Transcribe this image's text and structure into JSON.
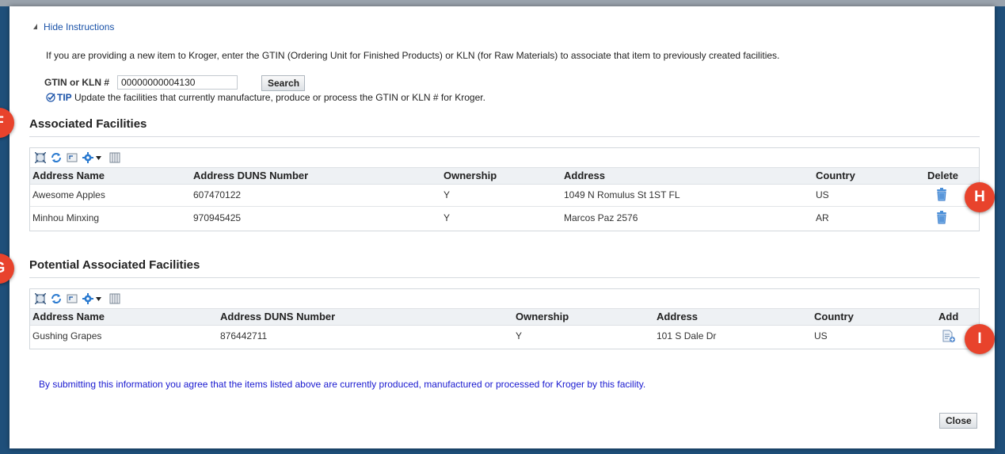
{
  "instructions": {
    "toggle_label": "Hide Instructions",
    "text": "If you are providing a new item to Kroger, enter the GTIN (Ordering Unit for Finished Products) or KLN (for Raw Materials) to associate that item to previously created facilities."
  },
  "search": {
    "label": "GTIN or KLN #",
    "value": "00000000004130",
    "button_label": "Search",
    "tip_word": "TIP",
    "tip_text": " Update the facilities that currently manufacture, produce or process the GTIN or KLN # for Kroger."
  },
  "associated": {
    "title": "Associated Facilities",
    "columns": [
      "Address Name",
      "Address DUNS Number",
      "Ownership",
      "Address",
      "Country",
      "Delete"
    ],
    "rows": [
      {
        "name": "Awesome Apples",
        "duns": "607470122",
        "ownership": "Y",
        "address": "1049 N Romulus St 1ST FL",
        "country": "US"
      },
      {
        "name": "Minhou Minxing",
        "duns": "970945425",
        "ownership": "Y",
        "address": "Marcos Paz 2576",
        "country": "AR"
      }
    ]
  },
  "potential": {
    "title": "Potential Associated Facilities",
    "columns": [
      "Address Name",
      "Address DUNS Number",
      "Ownership",
      "Address",
      "Country",
      "Add"
    ],
    "rows": [
      {
        "name": "Gushing Grapes",
        "duns": "876442711",
        "ownership": "Y",
        "address": "101 S Dale Dr",
        "country": "US"
      }
    ]
  },
  "agreement_text": "By submitting this information you agree that the items listed above are currently produced, manufactured or processed for Kroger by this facility.",
  "close_label": "Close",
  "callouts": {
    "f": "F",
    "g": "G",
    "h": "H",
    "i": "I"
  },
  "colors": {
    "callout": "#e8432c",
    "link": "#1a52a8",
    "agreement": "#1a1ad0"
  },
  "toolbar_icons": [
    "detach-icon",
    "refresh-icon",
    "reset-icon",
    "gear-icon",
    "dropdown-icon",
    "freeze-columns-icon"
  ]
}
